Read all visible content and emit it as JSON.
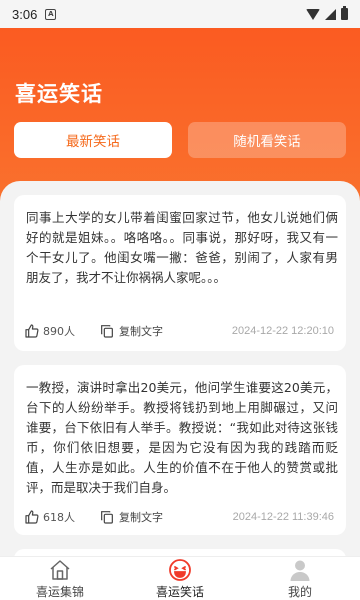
{
  "status_bar": {
    "time": "3:06",
    "notification_icon": "app-notification-icon",
    "icons": [
      "wifi-icon",
      "signal-icon",
      "battery-icon"
    ]
  },
  "header": {
    "title": "喜运笑话",
    "tabs": [
      {
        "label": "最新笑话",
        "active": true
      },
      {
        "label": "随机看笑话",
        "active": false
      }
    ]
  },
  "jokes": [
    {
      "text": "同事上大学的女儿带着闺蜜回家过节，他女儿说她们俩好的就是姐妹。。咯咯咯。。同事说，那好呀，我又有一个干女儿了。他闺女嘴一撇：爸爸，别闹了，人家有男朋友了，我才不让你祸祸人家呢。。。",
      "likes": "890人",
      "copy_label": "复制文字",
      "timestamp": "2024-12-22 12:20:10"
    },
    {
      "text": "一教授，演讲时拿出20美元，他问学生谁要这20美元，台下的人纷纷举手。教授将钱扔到地上用脚碾过，又问谁要，台下依旧有人举手。教授说：“我如此对待这张钱币，你们依旧想要，是因为它没有因为我的践踏而贬值，人生亦是如此。人生的价值不在于他人的赞赏或批评，而是取决于我们自身。",
      "likes": "618人",
      "copy_label": "复制文字",
      "timestamp": "2024-12-22 11:39:46"
    }
  ],
  "bottom_nav": [
    {
      "label": "喜运集锦",
      "icon": "home-icon",
      "active": false
    },
    {
      "label": "喜运笑话",
      "icon": "laughing-face-icon",
      "active": true
    },
    {
      "label": "我的",
      "icon": "user-icon",
      "active": false
    }
  ],
  "colors": {
    "brand_orange": "#fb5b21",
    "active_tab_text": "#f56a1c",
    "background": "#f3f3f3"
  }
}
